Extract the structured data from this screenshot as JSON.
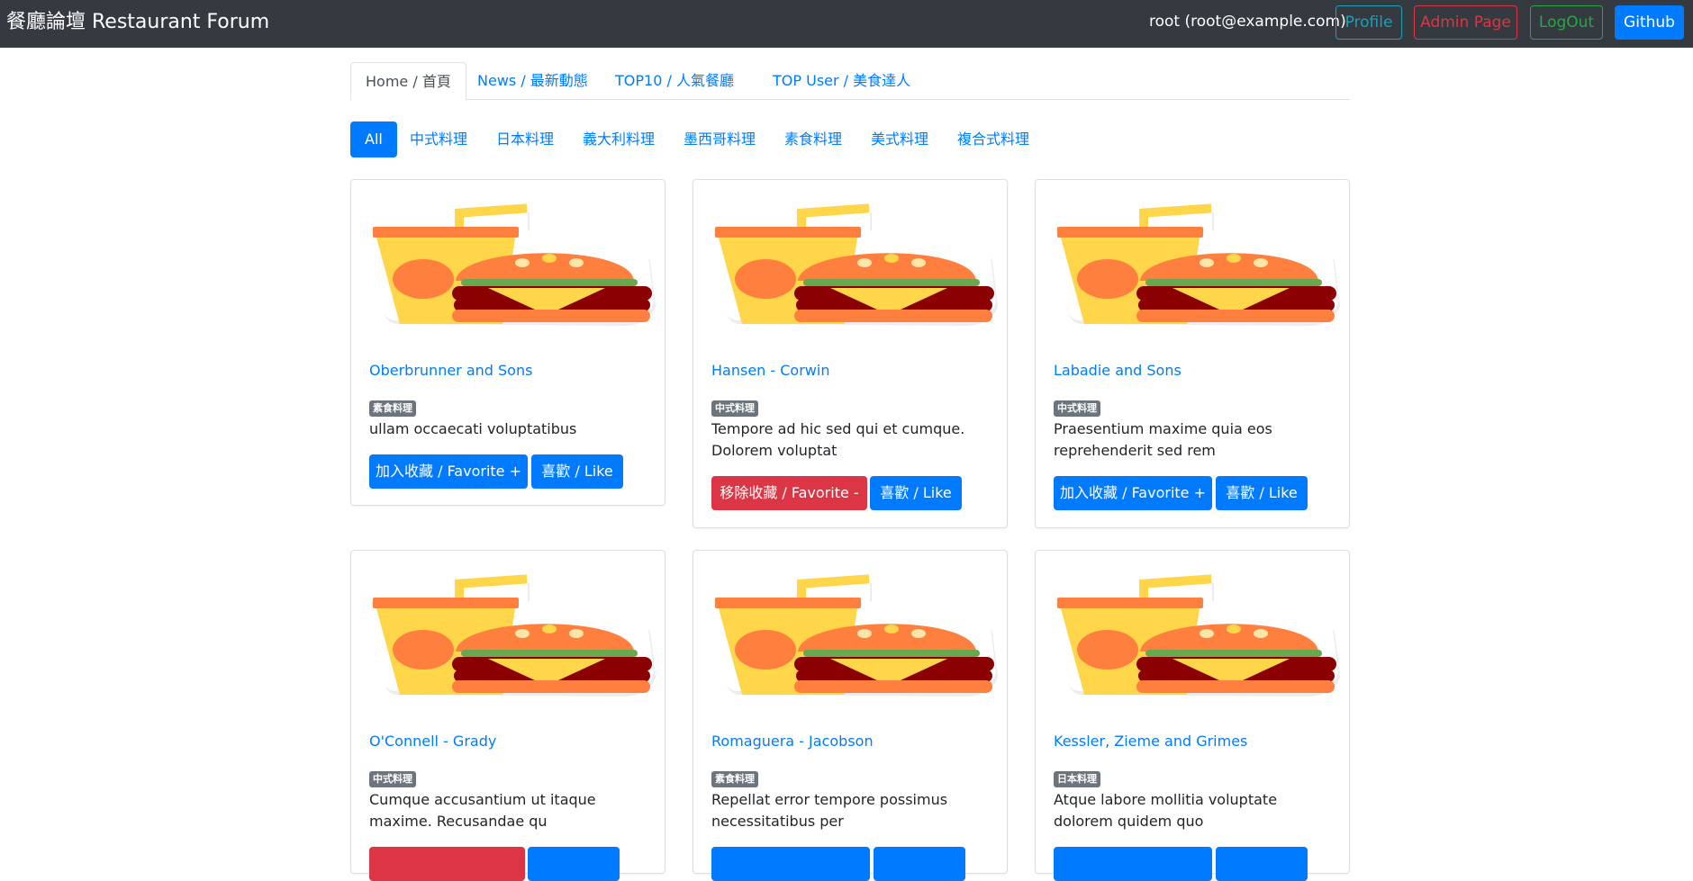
{
  "navbar": {
    "brand": "餐廳論壇 Restaurant Forum",
    "user": "root (root@example.com)",
    "buttons": {
      "profile": "Profile",
      "admin": "Admin Page",
      "logout": "LogOut",
      "github": "Github"
    }
  },
  "tabs": [
    {
      "label": "Home / 首頁",
      "active": true
    },
    {
      "label": "News / 最新動態",
      "active": false
    },
    {
      "label": "TOP10 / 人氣餐廳",
      "active": false
    },
    {
      "label": "TOP User / 美食達人",
      "active": false
    }
  ],
  "categories": [
    {
      "label": "All",
      "active": true
    },
    {
      "label": "中式料理",
      "active": false
    },
    {
      "label": "日本料理",
      "active": false
    },
    {
      "label": "義大利料理",
      "active": false
    },
    {
      "label": "墨西哥料理",
      "active": false
    },
    {
      "label": "素食料理",
      "active": false
    },
    {
      "label": "美式料理",
      "active": false
    },
    {
      "label": "複合式料理",
      "active": false
    }
  ],
  "restaurants": [
    {
      "name": "Oberbrunner and Sons",
      "category": "素食料理",
      "description": "ullam occaecati voluptatibus",
      "favorite_label": "加入收藏 / Favorite +",
      "favorited": false,
      "like_label": "喜歡 / Like"
    },
    {
      "name": "Hansen - Corwin",
      "category": "中式料理",
      "description": "Tempore ad hic sed qui et cumque. Dolorem voluptat",
      "favorite_label": "移除收藏 / Favorite -",
      "favorited": true,
      "like_label": "喜歡 / Like"
    },
    {
      "name": "Labadie and Sons",
      "category": "中式料理",
      "description": "Praesentium maxime quia eos reprehenderit sed rem",
      "favorite_label": "加入收藏 / Favorite +",
      "favorited": false,
      "like_label": "喜歡 / Like"
    },
    {
      "name": "O'Connell - Grady",
      "category": "中式料理",
      "description": "Cumque accusantium ut itaque maxime. Recusandae qu",
      "favorited": true
    },
    {
      "name": "Romaguera - Jacobson",
      "category": "素食料理",
      "description": "Repellat error tempore possimus necessitatibus per",
      "favorited": false
    },
    {
      "name": "Kessler, Zieme and Grimes",
      "category": "日本料理",
      "description": "Atque labore mollitia voluptate dolorem quidem quo",
      "favorited": false
    }
  ],
  "colors": {
    "navbar_bg": "#343a40",
    "primary": "#007bff",
    "danger": "#dc3545",
    "info": "#17a2b8",
    "success": "#28a745",
    "badge": "#6c757d"
  },
  "icons": {
    "restaurant_image": "burger-and-drink-illustration"
  }
}
